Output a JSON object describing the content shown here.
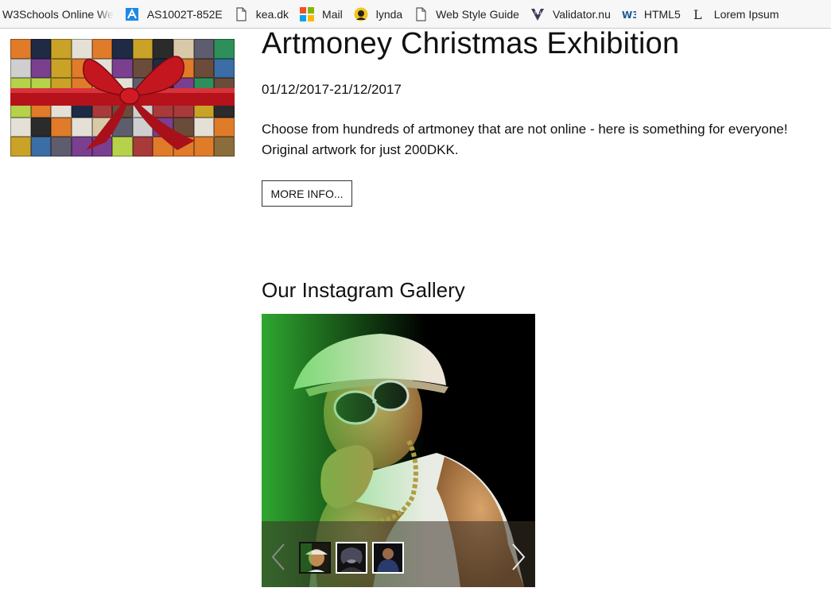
{
  "bookmarks": [
    {
      "label": "W3Schools Online We",
      "icon": "w3schools-icon"
    },
    {
      "label": "AS1002T-852E",
      "icon": "router-icon"
    },
    {
      "label": "kea.dk",
      "icon": "page-icon"
    },
    {
      "label": "Mail",
      "icon": "microsoft-icon"
    },
    {
      "label": "lynda",
      "icon": "lynda-icon"
    },
    {
      "label": "Web Style Guide",
      "icon": "page-icon"
    },
    {
      "label": "Validator.nu",
      "icon": "validator-icon"
    },
    {
      "label": "HTML5",
      "icon": "w3c-icon"
    },
    {
      "label": "Lorem Ipsum",
      "icon": "lorem-icon"
    }
  ],
  "exhibition": {
    "title": "Artmoney Christmas Exhibition",
    "dates": "01/12/2017-21/12/2017",
    "description_line1": "Choose from hundreds of artmoney that are not online - here is something for everyone!",
    "description_line2": "Original artwork for just 200DKK.",
    "more_button": "MORE INFO..."
  },
  "gallery": {
    "title": "Our Instagram Gallery",
    "thumb_count": 3,
    "active_thumb": 1
  }
}
